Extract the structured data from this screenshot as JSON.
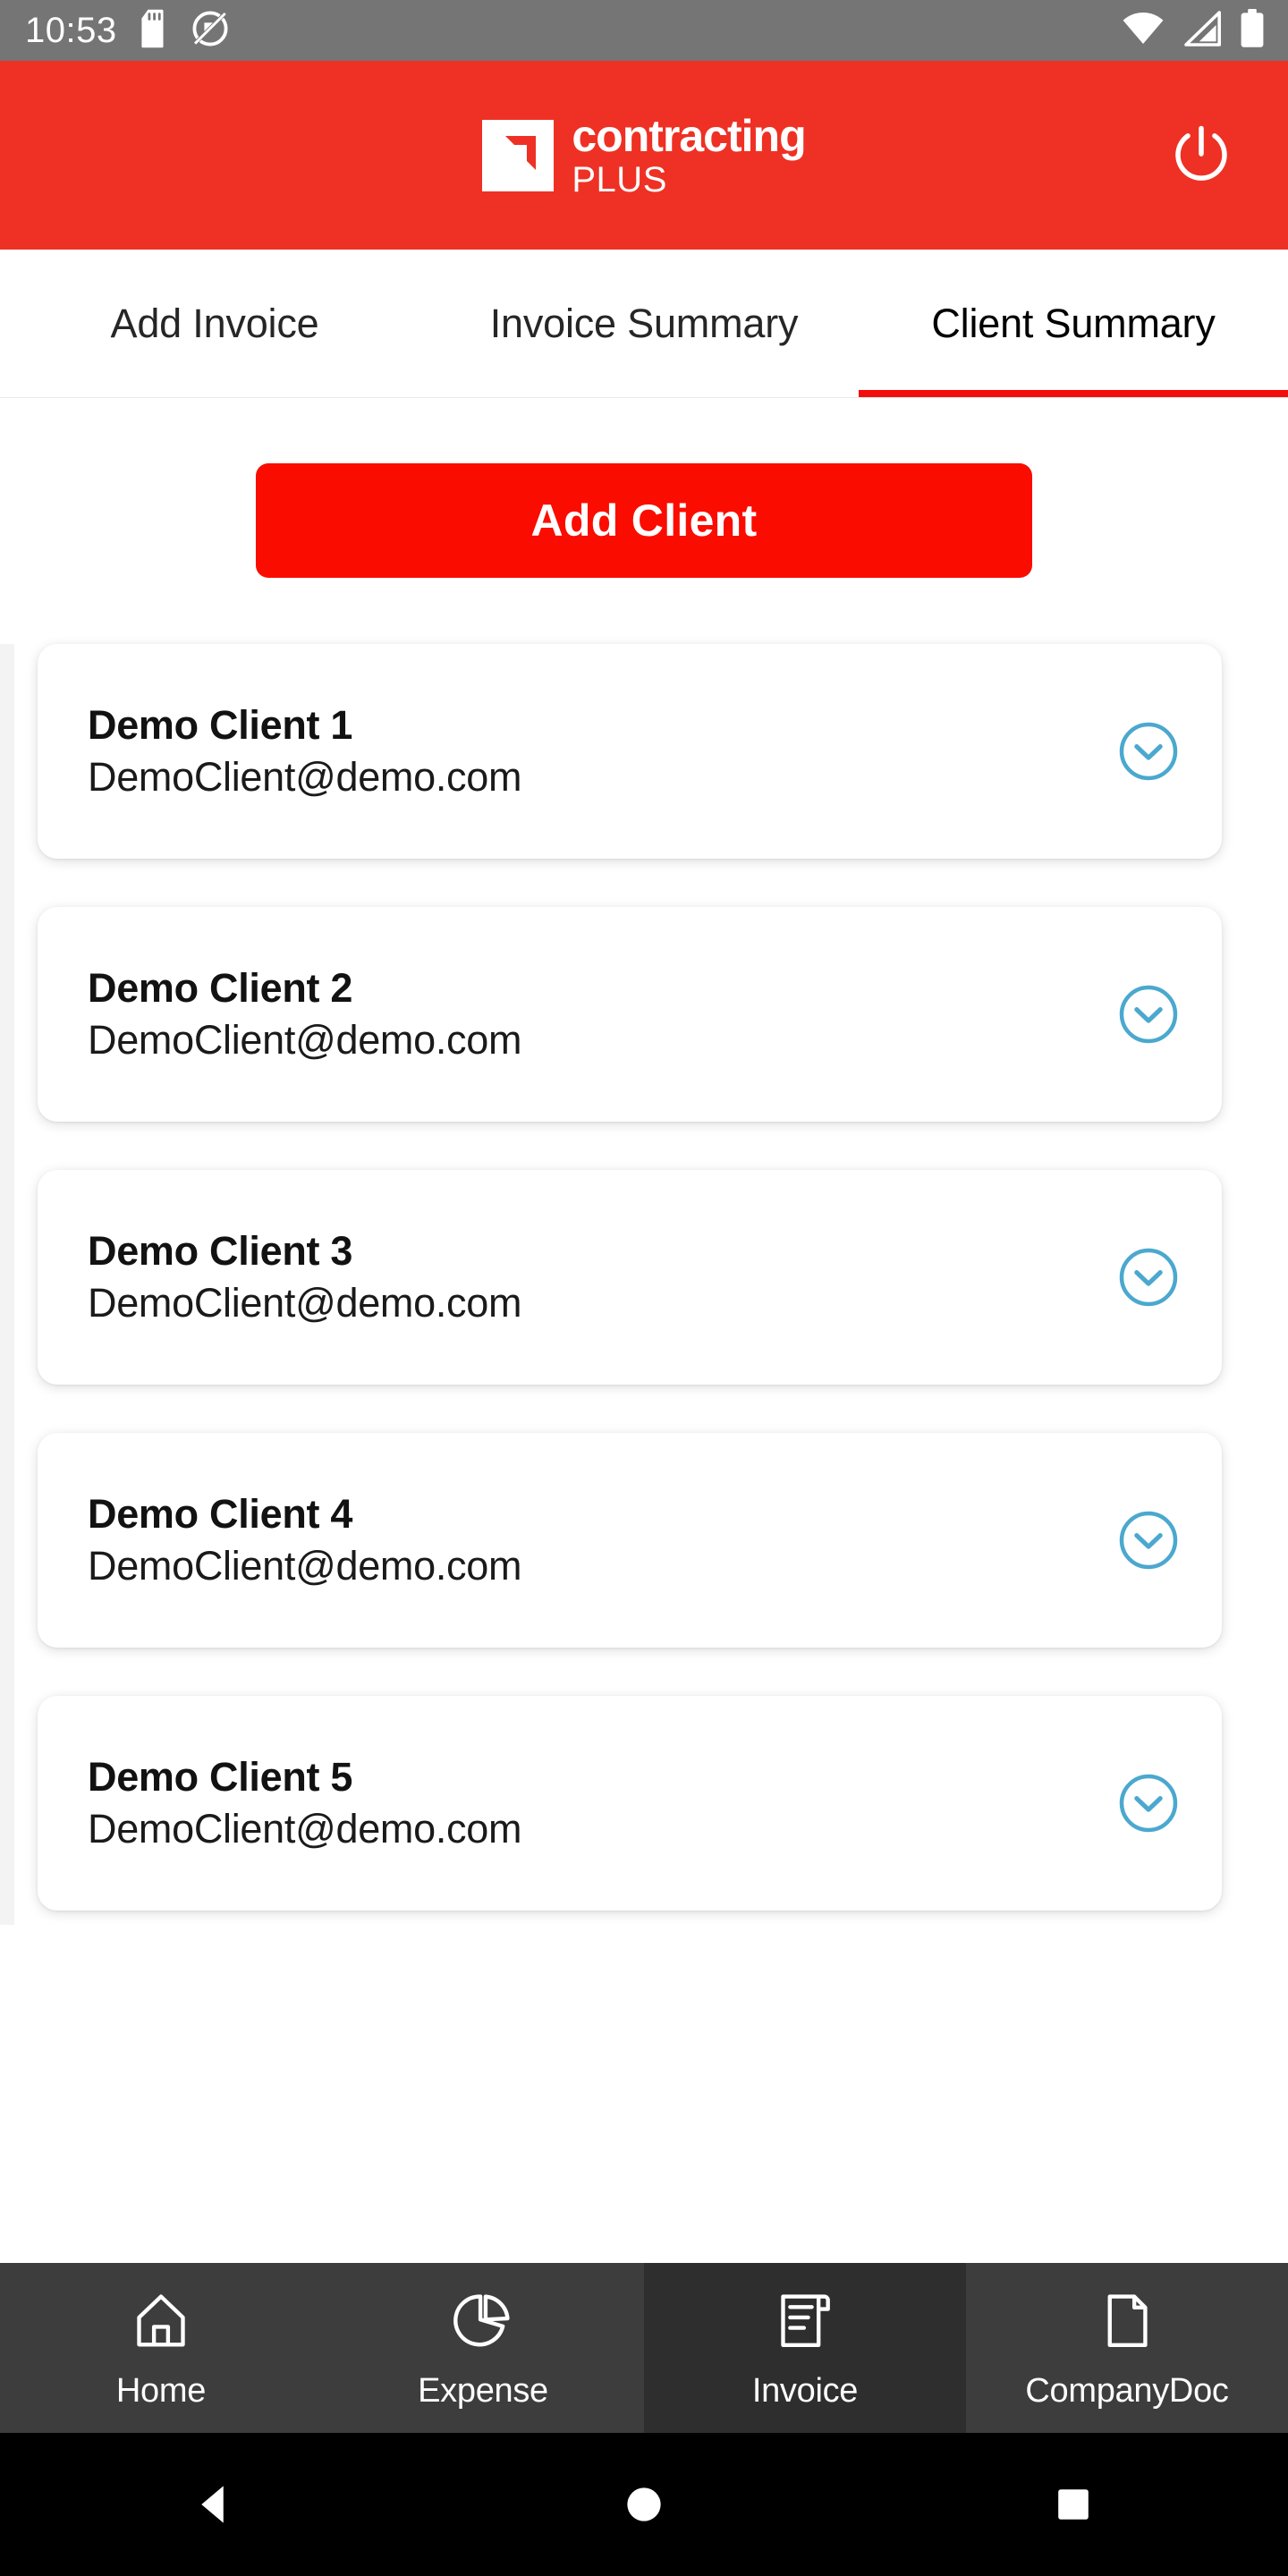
{
  "status_bar": {
    "time": "10:53",
    "left_icons": [
      "sd-card-icon",
      "data-saver-off-icon"
    ],
    "right_icons": [
      "wifi-icon",
      "cellular-signal-icon",
      "battery-icon"
    ],
    "background": "#757575"
  },
  "app_bar": {
    "logo_line1": "contracting",
    "logo_line2": "PLUS",
    "logo_mark": "arrow-corner-icon",
    "power_icon": "power-icon",
    "background": "#ee3124"
  },
  "tabs": {
    "items": [
      {
        "label": "Add Invoice",
        "active": false
      },
      {
        "label": "Invoice Summary",
        "active": false
      },
      {
        "label": "Client Summary",
        "active": true
      }
    ],
    "indicator_color": "#f20d0d"
  },
  "main": {
    "add_button_label": "Add Client",
    "add_button_color": "#fb0c00",
    "chevron_color": "#4ba8ce",
    "clients": [
      {
        "name": "Demo Client 1",
        "email": "DemoClient@demo.com",
        "expand_icon": "chevron-down-circle-icon"
      },
      {
        "name": "Demo Client 2",
        "email": "DemoClient@demo.com",
        "expand_icon": "chevron-down-circle-icon"
      },
      {
        "name": "Demo Client 3",
        "email": "DemoClient@demo.com",
        "expand_icon": "chevron-down-circle-icon"
      },
      {
        "name": "Demo Client 4",
        "email": "DemoClient@demo.com",
        "expand_icon": "chevron-down-circle-icon"
      },
      {
        "name": "Demo Client 5",
        "email": "DemoClient@demo.com",
        "expand_icon": "chevron-down-circle-icon"
      }
    ]
  },
  "bottom_nav": {
    "background": "#3d3d3d",
    "active_background": "#2e2e2e",
    "items": [
      {
        "label": "Home",
        "icon": "home-icon",
        "active": false
      },
      {
        "label": "Expense",
        "icon": "pie-chart-icon",
        "active": false
      },
      {
        "label": "Invoice",
        "icon": "invoice-receipt-icon",
        "active": true
      },
      {
        "label": "CompanyDoc",
        "icon": "document-page-icon",
        "active": false
      }
    ]
  },
  "android_nav": {
    "buttons": [
      "back-triangle-icon",
      "home-circle-icon",
      "recents-square-icon"
    ]
  }
}
